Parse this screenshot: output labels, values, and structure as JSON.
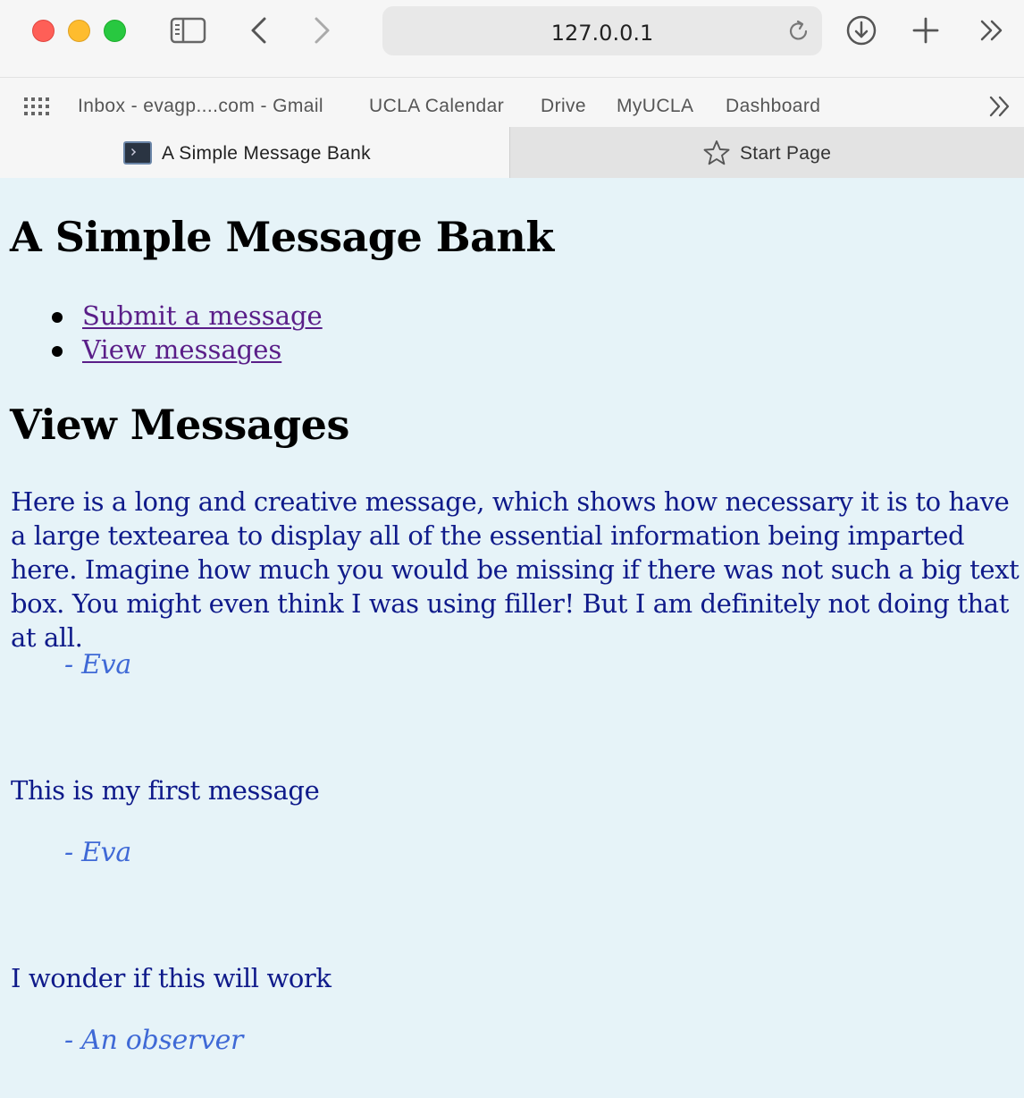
{
  "browser": {
    "address": "127.0.0.1",
    "bookmarks": [
      "Inbox - evagp....com - Gmail",
      "UCLA Calendar",
      "Drive",
      "MyUCLA",
      "Dashboard"
    ],
    "tabs": [
      {
        "title": "A Simple Message Bank",
        "active": true
      },
      {
        "title": "Start Page",
        "active": false
      }
    ]
  },
  "page": {
    "title": "A Simple Message Bank",
    "nav": [
      "Submit a message",
      "View messages"
    ],
    "section_title": "View Messages",
    "messages": [
      {
        "text": "Here is a long and creative message, which shows how necessary it is to have a large textearea to display all of the essential information being imparted here. Imagine how much you would be missing if there was not such a big text box. You might even think I was using filler! But I am definitely not doing that at all.",
        "author": "- Eva"
      },
      {
        "text": "This is my first message",
        "author": "- Eva"
      },
      {
        "text": "I wonder if this will work",
        "author": "- An observer"
      }
    ]
  },
  "colors": {
    "page_background": "#e6f3f8",
    "message_text": "#0f1a8a",
    "author_text": "#3f69d6",
    "visited_link": "#5a1e88"
  }
}
